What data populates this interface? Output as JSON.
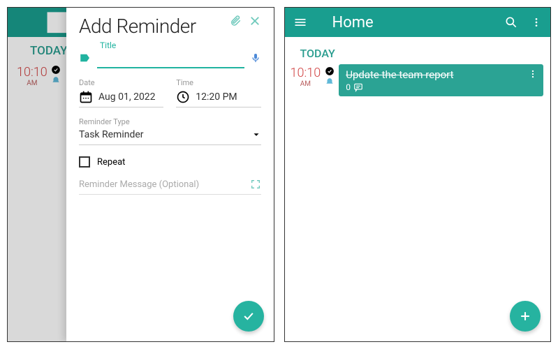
{
  "left": {
    "bg_today": "TODAY",
    "bg_time": "10:10",
    "bg_ampm": "AM",
    "modal_title": "Add Reminder",
    "title_label": "Title",
    "date_label": "Date",
    "date_value": "Aug 01, 2022",
    "time_label": "Time",
    "time_value": "12:20 PM",
    "type_label": "Reminder Type",
    "type_value": "Task Reminder",
    "repeat_label": "Repeat",
    "message_placeholder": "Reminder Message (Optional)"
  },
  "right": {
    "header_title": "Home",
    "today_label": "TODAY",
    "task_time": "10:10",
    "task_ampm": "AM",
    "task_title": "Update the team report",
    "task_comment_count": "0"
  }
}
